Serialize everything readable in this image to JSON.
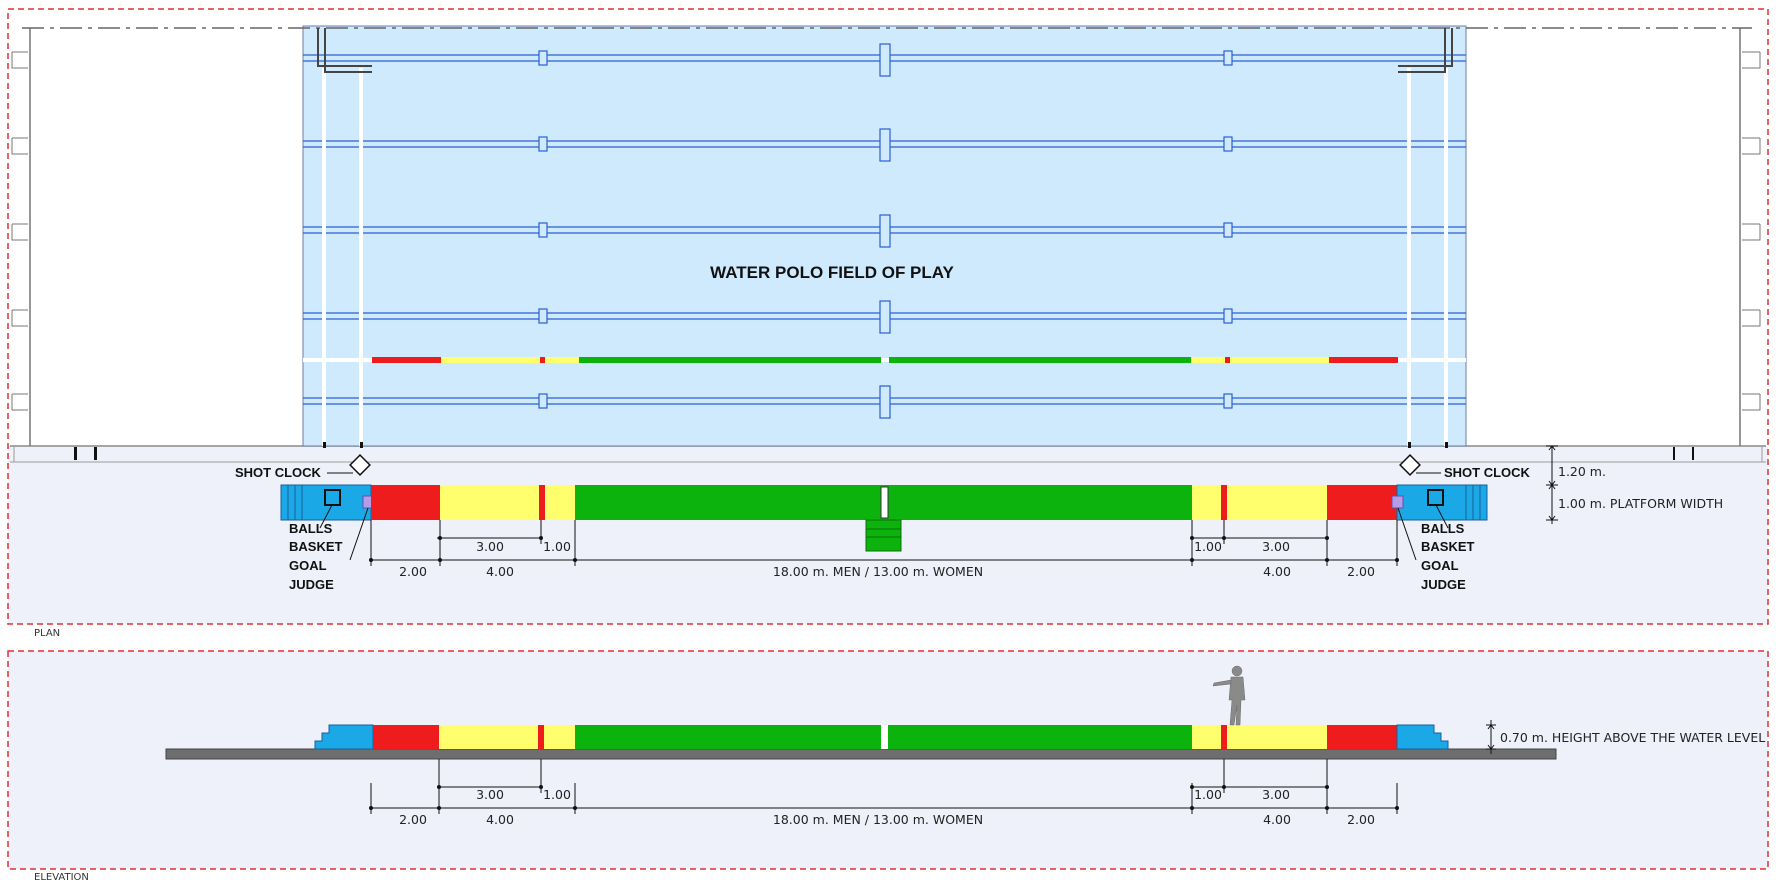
{
  "plan": {
    "title": "WATER POLO FIELD OF PLAY",
    "caption": "PLAN",
    "shot_clock_left": "SHOT CLOCK",
    "shot_clock_right": "SHOT CLOCK",
    "balls_basket_left": [
      "BALLS",
      "BASKET"
    ],
    "goal_judge_left": [
      "GOAL",
      "JUDGE"
    ],
    "balls_basket_right": [
      "BALLS",
      "BASKET"
    ],
    "goal_judge_right": [
      "GOAL",
      "JUDGE"
    ],
    "platform_offset": "1.20 m.",
    "platform_width": "1.00 m. PLATFORM WIDTH",
    "dims": {
      "d300_left": "3.00",
      "d100_left": "1.00",
      "d200_left": "2.00",
      "d400_left": "4.00",
      "center": "18.00 m. MEN  / 13.00 m. WOMEN",
      "d100_right": "1.00",
      "d300_right": "3.00",
      "d400_right": "4.00",
      "d200_right": "2.00"
    }
  },
  "elevation": {
    "caption": "ELEVATION",
    "height_note": "0.70 m.  HEIGHT ABOVE THE WATER LEVEL",
    "dims": {
      "d300_left": "3.00",
      "d100_left": "1.00",
      "d200_left": "2.00",
      "d400_left": "4.00",
      "center": "18.00 m. MEN  / 13.00 m. WOMEN",
      "d100_right": "1.00",
      "d300_right": "3.00",
      "d400_right": "4.00",
      "d200_right": "2.00"
    }
  },
  "colors": {
    "pool_water": "#cfeafc",
    "deck": "#eef1fa",
    "frame_dash": "#e03030",
    "zone_red": "#ee1c1c",
    "zone_yellow": "#ffff6e",
    "zone_green": "#0cb30c",
    "goal_blue": "#1aa9e6",
    "lane_rope": "#2a5fd6",
    "goal_judge_marker": "#b59ce8"
  }
}
